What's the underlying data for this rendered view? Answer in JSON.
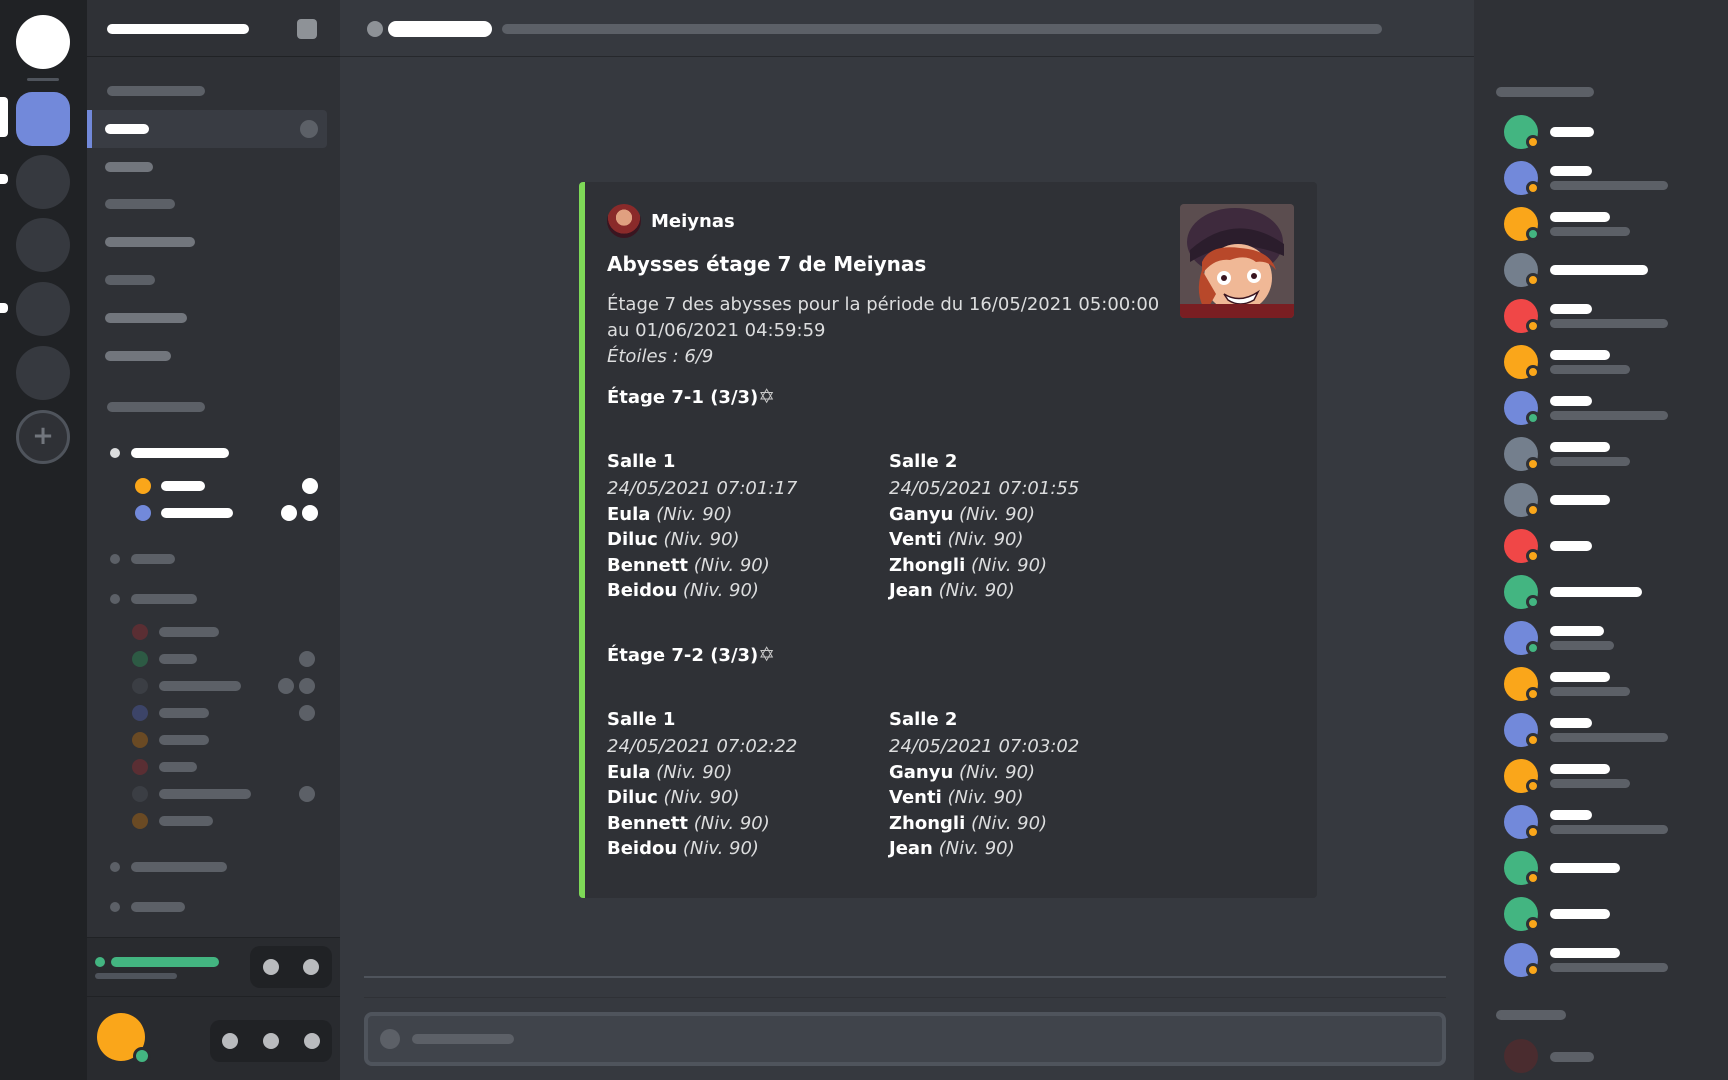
{
  "embed": {
    "author": "Meiynas",
    "title": "Abysses étage 7 de Meiynas",
    "description": "Étage 7 des abysses pour la période du 16/05/2021 05:00:00 au 01/06/2021 04:59:59",
    "stars_line": "Étoiles : 6/9",
    "accent_color": "#7ed957",
    "floors": [
      {
        "title": "Étage 7-1 (3/3)",
        "star_icon": "✡",
        "rooms": [
          {
            "title": "Salle 1",
            "time": "24/05/2021 07:01:17",
            "chars": [
              {
                "name": "Eula",
                "level": "(Niv. 90)"
              },
              {
                "name": "Diluc",
                "level": "(Niv. 90)"
              },
              {
                "name": "Bennett",
                "level": "(Niv. 90)"
              },
              {
                "name": "Beidou",
                "level": "(Niv. 90)"
              }
            ]
          },
          {
            "title": "Salle 2",
            "time": "24/05/2021 07:01:55",
            "chars": [
              {
                "name": "Ganyu",
                "level": "(Niv. 90)"
              },
              {
                "name": "Venti",
                "level": "(Niv. 90)"
              },
              {
                "name": "Zhongli",
                "level": "(Niv. 90)"
              },
              {
                "name": "Jean",
                "level": "(Niv. 90)"
              }
            ]
          }
        ]
      },
      {
        "title": "Étage 7-2 (3/3)",
        "star_icon": "✡",
        "rooms": [
          {
            "title": "Salle 1",
            "time": "24/05/2021 07:02:22",
            "chars": [
              {
                "name": "Eula",
                "level": "(Niv. 90)"
              },
              {
                "name": "Diluc",
                "level": "(Niv. 90)"
              },
              {
                "name": "Bennett",
                "level": "(Niv. 90)"
              },
              {
                "name": "Beidou",
                "level": "(Niv. 90)"
              }
            ]
          },
          {
            "title": "Salle 2",
            "time": "24/05/2021 07:03:02",
            "chars": [
              {
                "name": "Ganyu",
                "level": "(Niv. 90)"
              },
              {
                "name": "Venti",
                "level": "(Niv. 90)"
              },
              {
                "name": "Zhongli",
                "level": "(Niv. 90)"
              },
              {
                "name": "Jean",
                "level": "(Niv. 90)"
              }
            ]
          }
        ]
      }
    ]
  },
  "colors": {
    "accent_blurple": "#7289da",
    "online": "#43b581",
    "idle": "#faa61a",
    "dnd": "#f04747"
  },
  "members": [
    {
      "avatar": "#43b581",
      "status": "#faa61a"
    },
    {
      "avatar": "#7289da",
      "status": "#faa61a"
    },
    {
      "avatar": "#faa61a",
      "status": "#43b581"
    },
    {
      "avatar": "#747f8d",
      "status": "#faa61a"
    },
    {
      "avatar": "#f04747",
      "status": "#faa61a"
    },
    {
      "avatar": "#faa61a",
      "status": "#faa61a"
    },
    {
      "avatar": "#7289da",
      "status": "#43b581"
    },
    {
      "avatar": "#747f8d",
      "status": "#faa61a"
    },
    {
      "avatar": "#747f8d",
      "status": "#faa61a"
    },
    {
      "avatar": "#f04747",
      "status": "#faa61a"
    },
    {
      "avatar": "#43b581",
      "status": "#43b581"
    },
    {
      "avatar": "#7289da",
      "status": "#43b581"
    },
    {
      "avatar": "#faa61a",
      "status": "#faa61a"
    },
    {
      "avatar": "#7289da",
      "status": "#faa61a"
    },
    {
      "avatar": "#faa61a",
      "status": "#faa61a"
    },
    {
      "avatar": "#7289da",
      "status": "#faa61a"
    },
    {
      "avatar": "#43b581",
      "status": "#faa61a"
    },
    {
      "avatar": "#43b581",
      "status": "#faa61a"
    },
    {
      "avatar": "#7289da",
      "status": "#faa61a"
    }
  ]
}
